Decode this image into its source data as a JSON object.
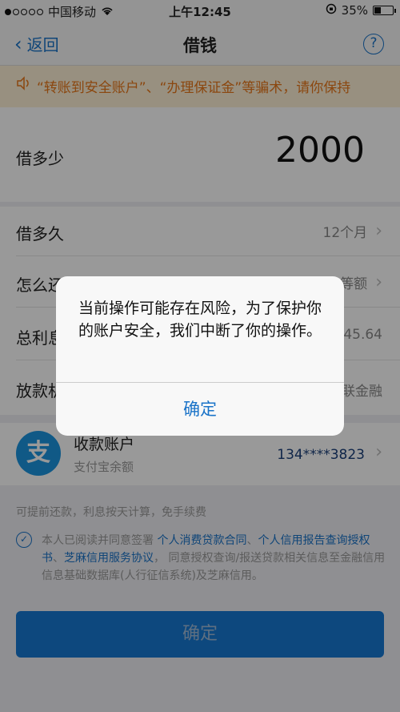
{
  "status_bar": {
    "carrier": "中国移动",
    "time": "上午12:45",
    "battery": "35%",
    "battery_level": 0.35
  },
  "nav": {
    "back_label": "返回",
    "title": "借钱",
    "help_label": "?"
  },
  "notice": {
    "text": "“转账到安全账户”、“办理保证金”等骗术，请你保持"
  },
  "form": {
    "amount_label": "借多少",
    "amount_value": "2000",
    "duration_label": "借多久",
    "duration_value": "12个月",
    "repay_label": "怎么还",
    "repay_value": "等额",
    "interest_label": "总利息",
    "interest_value": "245.64",
    "lender_label": "放款机构",
    "lender_value": "联金融"
  },
  "account": {
    "icon_char": "支",
    "title": "收款账户",
    "subtitle": "支付宝余额",
    "number": "134****3823"
  },
  "tip": "可提前还款，利息按天计算，免手续费",
  "agreement": {
    "prefix": "本人已阅读并同意签署 ",
    "link1": "个人消费贷款合同",
    "sep1": "、",
    "link2": "个人信用报告查询授权书",
    "sep2": "、",
    "link3": "芝麻信用服务协议",
    "suffix": "， 同意授权查询/报送贷款相关信息至金融信用信息基础数据库(人行征信系统)及芝麻信用。"
  },
  "main_button": "确定",
  "dialog": {
    "message": "当前操作可能存在风险，为了保护你的账户安全，我们中断了你的操作。",
    "confirm": "确定"
  }
}
